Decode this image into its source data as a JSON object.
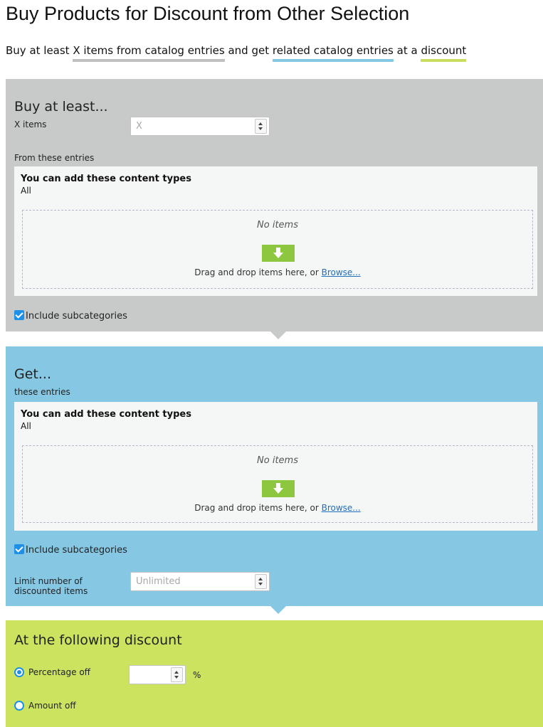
{
  "page": {
    "title": "Buy Products for Discount from Other Selection"
  },
  "summary": {
    "prefix": "Buy at least",
    "x_items": "X items from catalog entries",
    "middle": "and get",
    "related": "related catalog entries",
    "at_a": "at a",
    "discount": "discount"
  },
  "buy_section": {
    "heading": "Buy at least...",
    "x_items_label": "X items",
    "x_items_placeholder": "X",
    "from_label": "From these entries",
    "content_types_title": "You can add these content types",
    "content_types_value": "All",
    "empty_text": "No items",
    "drop_hint": "Drag and drop items here, or",
    "browse_link": "Browse...",
    "include_subcategories": "Include subcategories",
    "include_subcategories_checked": true
  },
  "get_section": {
    "heading": "Get...",
    "entries_label": "these entries",
    "content_types_title": "You can add these content types",
    "content_types_value": "All",
    "empty_text": "No items",
    "drop_hint": "Drag and drop items here, or",
    "browse_link": "Browse...",
    "include_subcategories": "Include subcategories",
    "include_subcategories_checked": true,
    "limit_label_line1": "Limit number of",
    "limit_label_line2": "discounted items",
    "limit_placeholder": "Unlimited"
  },
  "discount_section": {
    "heading": "At the following discount",
    "percentage_label": "Percentage off",
    "percentage_selected": true,
    "percentage_value": "",
    "percent_unit": "%",
    "amount_label": "Amount off",
    "amount_selected": false
  },
  "colors": {
    "buy_bg": "#c8c9c9",
    "get_bg": "#86c7e3",
    "discount_bg": "#cce35f",
    "accent": "#1e90e8",
    "drop_icon": "#8dc63f"
  }
}
